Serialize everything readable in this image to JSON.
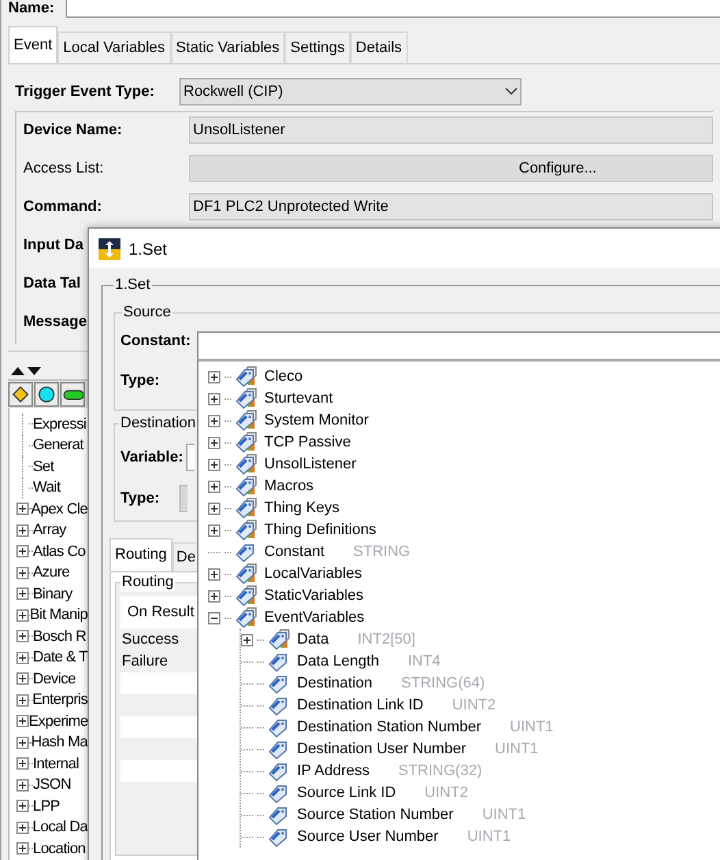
{
  "name_label": "Name:",
  "tabs": [
    {
      "label": "Event",
      "selected": true
    },
    {
      "label": "Local Variables",
      "selected": false
    },
    {
      "label": "Static Variables",
      "selected": false
    },
    {
      "label": "Settings",
      "selected": false
    },
    {
      "label": "Details",
      "selected": false
    }
  ],
  "trigger": {
    "label": "Trigger Event Type:",
    "value": "Rockwell (CIP)"
  },
  "fields": [
    {
      "kind": "text",
      "label": "Device Name:",
      "value": "UnsolListener"
    },
    {
      "kind": "button",
      "label": "Access List:",
      "value": "Configure..."
    },
    {
      "kind": "text",
      "label": "Command:",
      "value": "DF1 PLC2 Unprotected Write"
    },
    {
      "kind": "covered",
      "label": "Input Da"
    },
    {
      "kind": "covered",
      "label": "Data Tal"
    },
    {
      "kind": "covered",
      "label": "Message"
    }
  ],
  "palette": [
    {
      "kind": "leaf",
      "label": "Expressi"
    },
    {
      "kind": "leaf",
      "label": "Generat"
    },
    {
      "kind": "leaf",
      "label": "Set"
    },
    {
      "kind": "leaf",
      "label": "Wait"
    },
    {
      "kind": "group",
      "label": "Apex Cle"
    },
    {
      "kind": "group",
      "label": "Array"
    },
    {
      "kind": "group",
      "label": "Atlas Co"
    },
    {
      "kind": "group",
      "label": "Azure"
    },
    {
      "kind": "group",
      "label": "Binary"
    },
    {
      "kind": "group",
      "label": "Bit Manip"
    },
    {
      "kind": "group",
      "label": "Bosch R"
    },
    {
      "kind": "group",
      "label": "Date & T"
    },
    {
      "kind": "group",
      "label": "Device"
    },
    {
      "kind": "group",
      "label": "Enterpris"
    },
    {
      "kind": "group",
      "label": "Experime"
    },
    {
      "kind": "group",
      "label": "Hash Ma"
    },
    {
      "kind": "group",
      "label": "Internal"
    },
    {
      "kind": "group",
      "label": "JSON"
    },
    {
      "kind": "group",
      "label": "LPP"
    },
    {
      "kind": "group",
      "label": "Local Da"
    },
    {
      "kind": "group",
      "label": "Location"
    }
  ],
  "dialog": {
    "title": "1.Set",
    "group_title": "1.Set",
    "source": {
      "title": "Source",
      "constant_label": "Constant:",
      "type_label": "Type:"
    },
    "destination": {
      "title": "Destination",
      "variable_label": "Variable:",
      "type_label": "Type:"
    },
    "tabs": [
      {
        "label": "Routing",
        "selected": true
      },
      {
        "label": "De",
        "selected": false
      }
    ],
    "routing": {
      "title": "Routing",
      "column": "On Result",
      "rows": [
        "Success",
        "Failure"
      ]
    }
  },
  "popup": {
    "tree": [
      {
        "kind": "group",
        "label": "Cleco",
        "expanded": false
      },
      {
        "kind": "group",
        "label": "Sturtevant",
        "expanded": false
      },
      {
        "kind": "group",
        "label": "System Monitor",
        "expanded": false
      },
      {
        "kind": "group",
        "label": "TCP Passive",
        "expanded": false
      },
      {
        "kind": "group",
        "label": "UnsolListener",
        "expanded": false
      },
      {
        "kind": "group",
        "label": "Macros",
        "expanded": false
      },
      {
        "kind": "group",
        "label": "Thing Keys",
        "expanded": false
      },
      {
        "kind": "group",
        "label": "Thing Definitions",
        "expanded": false
      },
      {
        "kind": "tag",
        "label": "Constant",
        "type": "STRING"
      },
      {
        "kind": "group",
        "label": "LocalVariables",
        "expanded": false
      },
      {
        "kind": "group",
        "label": "StaticVariables",
        "expanded": false
      },
      {
        "kind": "group",
        "label": "EventVariables",
        "expanded": true,
        "children": [
          {
            "kind": "group",
            "label": "Data",
            "type": "INT2[50]",
            "expanded": false
          },
          {
            "kind": "tag",
            "label": "Data Length",
            "type": "INT4"
          },
          {
            "kind": "tag",
            "label": "Destination",
            "type": "STRING(64)"
          },
          {
            "kind": "tag",
            "label": "Destination Link ID",
            "type": "UINT2"
          },
          {
            "kind": "tag",
            "label": "Destination Station Number",
            "type": "UINT1"
          },
          {
            "kind": "tag",
            "label": "Destination User Number",
            "type": "UINT1"
          },
          {
            "kind": "tag",
            "label": "IP Address",
            "type": "STRING(32)"
          },
          {
            "kind": "tag",
            "label": "Source Link ID",
            "type": "UINT2"
          },
          {
            "kind": "tag",
            "label": "Source Station Number",
            "type": "UINT1"
          },
          {
            "kind": "tag",
            "label": "Source User Number",
            "type": "UINT1"
          }
        ]
      }
    ]
  }
}
